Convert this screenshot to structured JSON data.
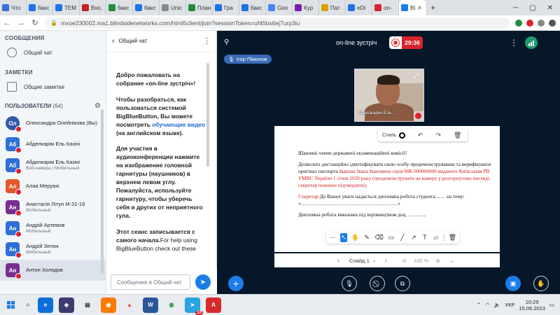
{
  "browser": {
    "tabs": [
      {
        "label": "Что",
        "color": "#3b6fd8",
        "active": false
      },
      {
        "label": "бакс",
        "color": "#1a73e8",
        "active": false
      },
      {
        "label": "TEM",
        "color": "#1a73e8",
        "active": false
      },
      {
        "label": "Вхо,",
        "color": "#c5221f",
        "active": false
      },
      {
        "label": "бакс",
        "color": "#1e8e3e",
        "active": false
      },
      {
        "label": "бакс",
        "color": "#1a73e8",
        "active": false
      },
      {
        "label": "Unic",
        "color": "#888888",
        "active": false
      },
      {
        "label": "План",
        "color": "#1e8e3e",
        "active": false
      },
      {
        "label": "Гра",
        "color": "#1a73e8",
        "active": false
      },
      {
        "label": "бакс",
        "color": "#1a73e8",
        "active": false
      },
      {
        "label": "Goo",
        "color": "#4285f4",
        "active": false
      },
      {
        "label": "Кур",
        "color": "#7b1fa2",
        "active": false
      },
      {
        "label": "Пат",
        "color": "#d9a000",
        "active": false
      },
      {
        "label": "eDi",
        "color": "#1a73e8",
        "active": false
      },
      {
        "label": "on-",
        "color": "#d9232d",
        "active": false
      },
      {
        "label": "Bl",
        "color": "#1b7ee8",
        "active": true
      }
    ],
    "url": "mxoe230002.ma1.blindsidenetworks.com/html5client/join?sessionToken=uf45bs6ej7urp3iu"
  },
  "sidebar": {
    "messages_heading": "СООБЩЕНИЯ",
    "public_chat": "Общий чат",
    "notes_heading": "ЗАМЕТКИ",
    "shared_notes": "Общие заметки",
    "users_heading": "ПОЛЬЗОВАТЕЛИ",
    "users_count": "(64)",
    "users": [
      {
        "initials": "Ол",
        "name": "Олександра Олейнікова (Вы)",
        "sub": "",
        "color": "#2e5aa8",
        "me": true,
        "selected": false
      },
      {
        "initials": "Аб",
        "name": "Абделкарім Ель Казіні",
        "sub": "",
        "color": "#2e6fd8",
        "me": false,
        "selected": false
      },
      {
        "initials": "Аб",
        "name": "Абделкарім Ель Казіні",
        "sub": "Веб-камера | Мобильный",
        "color": "#2e6fd8",
        "me": false,
        "selected": false
      },
      {
        "initials": "Ал",
        "name": "Алаа Меруахі",
        "sub": "",
        "color": "#e4572e",
        "me": false,
        "selected": false
      },
      {
        "initials": "Ан",
        "name": "Анастасія Літун М-31-19",
        "sub": "Мобильный",
        "color": "#7a2e8e",
        "me": false,
        "selected": false
      },
      {
        "initials": "Ан",
        "name": "Андрій Артемов",
        "sub": "Мобильный",
        "color": "#2e6fd8",
        "me": false,
        "selected": false
      },
      {
        "initials": "Ан",
        "name": "Андрій Зятюк",
        "sub": "Мобильный",
        "color": "#2e6fd8",
        "me": false,
        "selected": false
      },
      {
        "initials": "Ан",
        "name": "Антон Холодов",
        "sub": "",
        "color": "#7a2e8e",
        "me": false,
        "selected": true
      }
    ]
  },
  "chat": {
    "title": "Общий чат",
    "welcome_1": "Добро пожаловать на собрание «on-line зустріч»!",
    "welcome_2a": "Чтобы разобраться, как пользоваться системой BigBlueButton, Вы можете посмотреть ",
    "welcome_2_link": "обучающие видео",
    "welcome_2b": " (на английском языке).",
    "welcome_3": "Для участия в аудиоконференции нажмите на изображение головной гарнитуры (наушников) в верхнем левом углу. Пожалуйста, используйте гарнитуру, чтобы уберечь себя и других от неприятного гула.",
    "welcome_4a": "Этот сеанс записывается с самого начала.",
    "welcome_4b": "For help using BigBlueButton check out these",
    "input_placeholder": "Сообщение в Общий чат"
  },
  "meeting": {
    "title": "on-line зустріч",
    "record_time": "29:36",
    "talker": "Ігор Пімонов",
    "camera_label": "Абделкарім Ель...",
    "style_label": "Стиль",
    "slide_label": "Слайд 1",
    "zoom": "100 %"
  },
  "slide": {
    "p1": "Шановні члени державної екзаменаційної комісії!",
    "p2a": "Дозвольте дистанційно ідентифікувати свою особу продемонструвавши та верифікувати оригінал паспорта ",
    "p2b": "Іванова Івана Івановича серія МК 000000000 виданого Київським РВ УМВС України 1 січня 2020 року (продемонструвати на камеру у розгорнутому вигляді, секретар повинен підтвердити).",
    "p3a": "Секретар:",
    "p3b": "До Вашої уваги надається дипломна робота студента…… на тему:",
    "p3c": "«…………………………………………………»",
    "p4": "Дипломна робота виконана під керівництвом доц. ……….."
  },
  "taskbar": {
    "lang": "УКР",
    "time": "10:29",
    "date": "15.06.2023",
    "badge": "13"
  }
}
